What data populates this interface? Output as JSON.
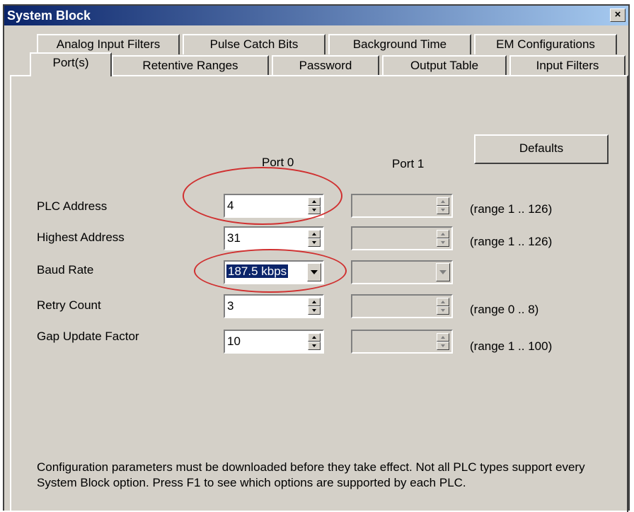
{
  "window": {
    "title": "System Block",
    "close_glyph": "×"
  },
  "tabs_back": [
    {
      "label": "Analog Input Filters"
    },
    {
      "label": "Pulse Catch Bits"
    },
    {
      "label": "Background Time"
    },
    {
      "label": "EM Configurations"
    }
  ],
  "tabs_front": [
    {
      "label": "Port(s)",
      "active": true
    },
    {
      "label": "Retentive Ranges"
    },
    {
      "label": "Password"
    },
    {
      "label": "Output Table"
    },
    {
      "label": "Input Filters"
    }
  ],
  "columns": {
    "port0": "Port 0",
    "port1": "Port 1"
  },
  "defaults_label": "Defaults",
  "rows": [
    {
      "label": "PLC Address",
      "port0": "4",
      "range": "(range 1 .. 126)"
    },
    {
      "label": "Highest Address",
      "port0": "31",
      "range": "(range 1 .. 126)"
    },
    {
      "label": "Baud Rate",
      "port0": "187.5 kbps",
      "range": ""
    },
    {
      "label": "Retry Count",
      "port0": "3",
      "range": "(range 0 .. 8)"
    },
    {
      "label": "Gap Update Factor",
      "port0": "10",
      "range": "(range 1 .. 100)"
    }
  ],
  "note": "Configuration parameters must be downloaded before they take effect. Not all PLC types support every System Block option. Press F1 to see which options are supported by each PLC.",
  "colors": {
    "titlebar": "#0a246a",
    "face": "#d4d0c8",
    "highlight_ellipse": "#d03030",
    "selection": "#0a246a"
  }
}
